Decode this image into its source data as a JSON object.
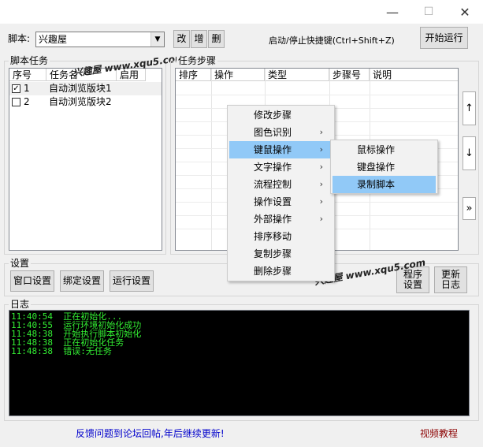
{
  "window": {
    "minimize_glyph": "—",
    "maximize_glyph": "☐",
    "close_glyph": "✕"
  },
  "toolbar": {
    "script_label": "脚本:",
    "script_selected": "兴趣屋",
    "edit_button": "改",
    "add_button": "增",
    "delete_button": "删",
    "hotkey_text": "启动/停止快捷键(Ctrl+Shift+Z)",
    "start_button": "开始运行"
  },
  "script_tasks": {
    "title": "脚本任务",
    "columns": [
      "序号",
      "任务名",
      "启用"
    ],
    "rows": [
      {
        "checked": true,
        "num": "1",
        "name": "自动浏览版块1"
      },
      {
        "checked": false,
        "num": "2",
        "name": "自动浏览版块2"
      }
    ]
  },
  "task_steps": {
    "title": "任务步骤",
    "columns": [
      "排序",
      "操作",
      "类型",
      "步骤号",
      "说明"
    ],
    "side_up": "↑",
    "side_down": "↓",
    "side_more": "»"
  },
  "context_menu": {
    "items": [
      {
        "label": "修改步骤",
        "arrow": ""
      },
      {
        "label": "图色识别",
        "arrow": "›"
      },
      {
        "label": "键鼠操作",
        "arrow": "›"
      },
      {
        "label": "文字操作",
        "arrow": "›"
      },
      {
        "label": "流程控制",
        "arrow": "›"
      },
      {
        "label": "操作设置",
        "arrow": "›"
      },
      {
        "label": "外部操作",
        "arrow": "›"
      },
      {
        "label": "排序移动",
        "arrow": ""
      },
      {
        "label": "复制步骤",
        "arrow": ""
      },
      {
        "label": "删除步骤",
        "arrow": ""
      }
    ],
    "submenu": [
      {
        "label": "鼠标操作"
      },
      {
        "label": "键盘操作"
      },
      {
        "label": "录制脚本"
      }
    ]
  },
  "settings": {
    "title": "设置",
    "window_settings": "窗口设置",
    "bind_settings": "绑定设置",
    "run_settings": "运行设置",
    "program_settings": "程序\n设置",
    "update_log": "更新\n日志"
  },
  "log": {
    "title": "日志",
    "lines": [
      {
        "time": "11:40:54",
        "msg": "正在初始化..."
      },
      {
        "time": "11:40:55",
        "msg": "运行环境初始化成功"
      },
      {
        "time": "11:48:38",
        "msg": "开始执行脚本初始化"
      },
      {
        "time": "11:48:38",
        "msg": "正在初始化任务"
      },
      {
        "time": "11:48:38",
        "msg": "错误:无任务"
      }
    ]
  },
  "footer": {
    "feedback": "反馈问题到论坛回帖,年后继续更新!",
    "video": "视频教程"
  },
  "watermark": {
    "text1": "兴趣屋 www.xqu5.com",
    "text2": "兴趣屋 www.xqu5.com"
  },
  "colors": {
    "highlight": "#91c9f7",
    "log_text": "#33ee33",
    "feedback": "#0000cc",
    "video": "#8b0000"
  }
}
